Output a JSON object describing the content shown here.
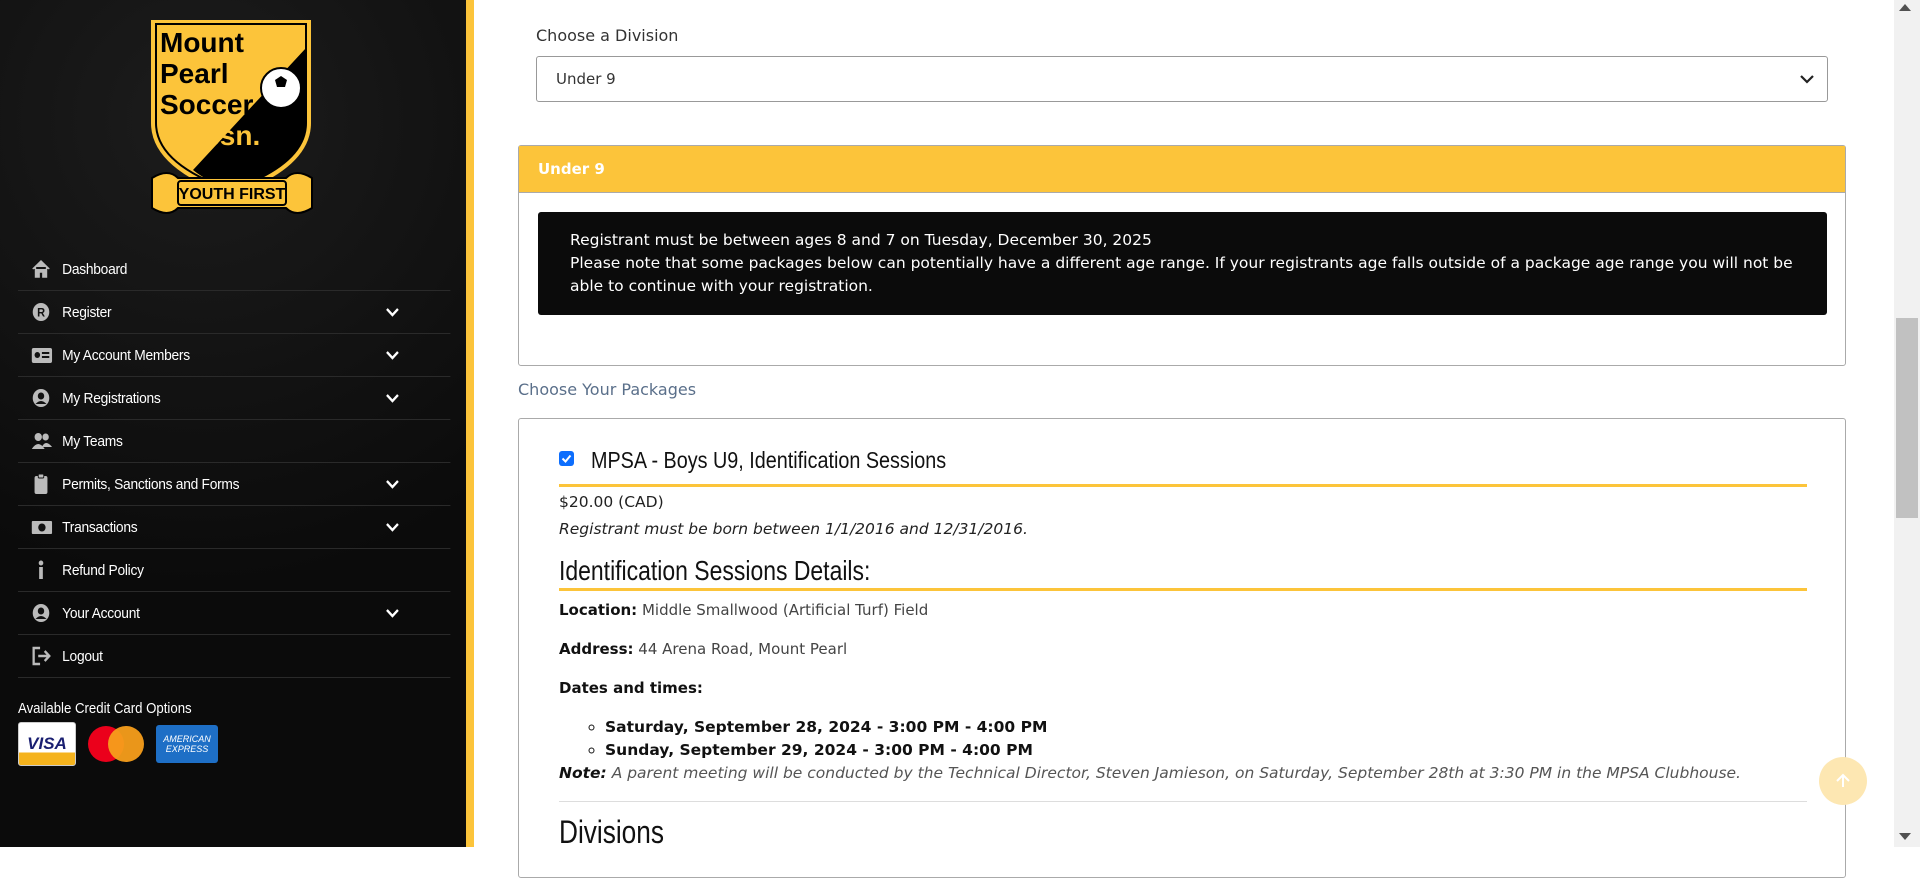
{
  "logo": {
    "line1": "Mount",
    "line2": "Pearl",
    "line3": "Soccer",
    "line4": "Assn.",
    "ribbon": "YOUTH FIRST"
  },
  "sidebar": {
    "items": [
      {
        "label": "Dashboard",
        "icon": "home-icon",
        "expandable": false
      },
      {
        "label": "Register",
        "icon": "register-icon",
        "expandable": true
      },
      {
        "label": "My Account Members",
        "icon": "id-card-icon",
        "expandable": true
      },
      {
        "label": "My Registrations",
        "icon": "user-circle-icon",
        "expandable": true
      },
      {
        "label": "My Teams",
        "icon": "users-icon",
        "expandable": false
      },
      {
        "label": "Permits, Sanctions and Forms",
        "icon": "clipboard-icon",
        "expandable": true
      },
      {
        "label": "Transactions",
        "icon": "money-icon",
        "expandable": true
      },
      {
        "label": "Refund Policy",
        "icon": "info-icon",
        "expandable": false
      },
      {
        "label": "Your Account",
        "icon": "user-circle-icon",
        "expandable": true
      },
      {
        "label": "Logout",
        "icon": "logout-icon",
        "expandable": false
      }
    ],
    "cc_title": "Available Credit Card Options",
    "cards": {
      "visa": "VISA",
      "amex": "AMERICAN EXPRESS"
    }
  },
  "division": {
    "label": "Choose a Division",
    "selected": "Under 9"
  },
  "panel": {
    "title": "Under 9",
    "notice_line1": "Registrant must be between ages 8 and 7 on Tuesday, December 30, 2025",
    "notice_line2": "Please note that some packages below can potentially have a different age range. If your registrants age falls outside of a package age range you will not be able to continue with your registration."
  },
  "packages_label": "Choose Your Packages",
  "package": {
    "checked": true,
    "title": "MPSA - Boys U9, Identification Sessions",
    "price": "$20.00 (CAD)",
    "born": "Registrant must be born between 1/1/2016 and 12/31/2016.",
    "details_heading": "Identification Sessions Details:",
    "location_label": "Location:",
    "location": "Middle Smallwood (Artificial Turf) Field",
    "address_label": "Address:",
    "address": "44 Arena Road, Mount Pearl",
    "dates_label": "Dates and times:",
    "dates": [
      "Saturday, September 28, 2024 - 3:00 PM - 4:00 PM",
      "Sunday, September 29, 2024 - 3:00 PM - 4:00 PM"
    ],
    "note_label": "Note:",
    "note": "A parent meeting will be conducted by the Technical Director, Steven Jamieson, on Saturday, September 28th at 3:30 PM in the MPSA Clubhouse.",
    "divisions_heading": "Divisions"
  },
  "colors": {
    "accent": "#fcc43a",
    "sidebar_bg": "#0b0b0b",
    "notice_bg": "#0b0b0b",
    "checkbox": "#0d6efd"
  }
}
